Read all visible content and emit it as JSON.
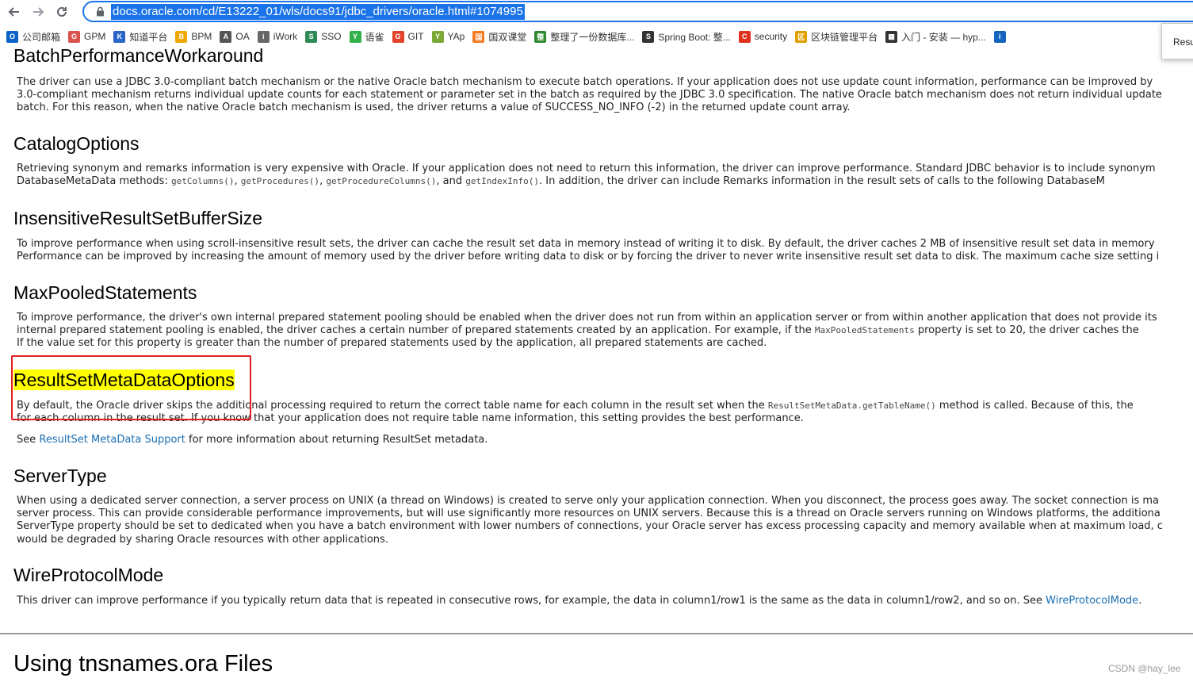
{
  "browser": {
    "url": "docs.oracle.com/cd/E13222_01/wls/docs91/jdbc_drivers/oracle.html#1074995",
    "popup_text": "Resu"
  },
  "bookmarks": [
    {
      "label": "公司邮箱",
      "icon": "mail-icon",
      "color": "#0a64c8",
      "glyph": "O"
    },
    {
      "label": "GPM",
      "icon": "gpm-icon",
      "color": "#d9534f",
      "glyph": "G"
    },
    {
      "label": "知道平台",
      "icon": "knowledge-icon",
      "color": "#2a66c9",
      "glyph": "K"
    },
    {
      "label": "BPM",
      "icon": "bpm-icon",
      "color": "#f0a800",
      "glyph": "B"
    },
    {
      "label": "OA",
      "icon": "oa-icon",
      "color": "#555555",
      "glyph": "A"
    },
    {
      "label": "iWork",
      "icon": "iwork-icon",
      "color": "#666666",
      "glyph": "i"
    },
    {
      "label": "SSO",
      "icon": "sso-icon",
      "color": "#2e8b57",
      "glyph": "S"
    },
    {
      "label": "语雀",
      "icon": "yuque-icon",
      "color": "#32b24a",
      "glyph": "Y"
    },
    {
      "label": "GIT",
      "icon": "gitlab-icon",
      "color": "#e24329",
      "glyph": "G"
    },
    {
      "label": "YAp",
      "icon": "yapi-icon",
      "color": "#7aa936",
      "glyph": "Y"
    },
    {
      "label": "国双课堂",
      "icon": "classroom-icon",
      "color": "#f47920",
      "glyph": "国"
    },
    {
      "label": "整理了一份数据库...",
      "icon": "database-icon",
      "color": "#2f8a2f",
      "glyph": "整"
    },
    {
      "label": "Spring Boot: 整...",
      "icon": "spring-icon",
      "color": "#333333",
      "glyph": "S"
    },
    {
      "label": "security",
      "icon": "csdn-icon",
      "color": "#e0311f",
      "glyph": "C"
    },
    {
      "label": "区块链管理平台",
      "icon": "blockchain-icon",
      "color": "#e0a000",
      "glyph": "区"
    },
    {
      "label": "入门 - 安装 — hyp...",
      "icon": "doc-icon",
      "color": "#333333",
      "glyph": "▦"
    },
    {
      "label": "",
      "icon": "info-icon",
      "color": "#1565c0",
      "glyph": "i"
    }
  ],
  "sections": {
    "batch": {
      "title": "BatchPerformanceWorkaround",
      "line1": "The driver can use a JDBC 3.0-compliant batch mechanism or the native Oracle batch mechanism to execute batch operations. If your application does not use update count information, performance can be improved by",
      "line2": "3.0-compliant mechanism returns individual update counts for each statement or parameter set in the batch as required by the JDBC 3.0 specification. The native Oracle batch mechanism does not return individual update",
      "line3": "batch. For this reason, when the native Oracle batch mechanism is used, the driver returns a value of SUCCESS_NO_INFO (-2) in the returned update count array."
    },
    "catalog": {
      "title": "CatalogOptions",
      "line1": "Retrieving synonym and remarks information is very expensive with Oracle. If your application does not need to return this information, the driver can improve performance. Standard JDBC behavior is to include synonym",
      "line2_a": "DatabaseMetaData methods: ",
      "code1": "getColumns()",
      "sep1": ", ",
      "code2": "getProcedures()",
      "sep2": ", ",
      "code3": "getProcedureColumns()",
      "sep3": ", and ",
      "code4": "getIndexInfo()",
      "line2_b": ". In addition, the driver can include Remarks information in the result sets of calls to the following DatabaseM"
    },
    "insensitive": {
      "title": "InsensitiveResultSetBufferSize",
      "line1": "To improve performance when using scroll-insensitive result sets, the driver can cache the result set data in memory instead of writing it to disk. By default, the driver caches 2 MB of insensitive result set data in memory",
      "line2": "Performance can be improved by increasing the amount of memory used by the driver before writing data to disk or by forcing the driver to never write insensitive result set data to disk. The maximum cache size setting i"
    },
    "maxpooled": {
      "title": "MaxPooledStatements",
      "line1": "To improve performance, the driver's own internal prepared statement pooling should be enabled when the driver does not run from within an application server or from within another application that does not provide its",
      "line2_a": "internal prepared statement pooling is enabled, the driver caches a certain number of prepared statements created by an application. For example, if the ",
      "code1": "MaxPooledStatements",
      "line2_b": " property is set to 20, the driver caches the",
      "line3": "If the value set for this property is greater than the number of prepared statements used by the application, all prepared statements are cached."
    },
    "rsmeta": {
      "title": "ResultSetMetaDataOptions",
      "line1_a": "By default, the Oracle driver skips the additional processing required to return the correct table name for each column in the result set when the ",
      "code1": "ResultSetMetaData.getTableName()",
      "line1_b": " method is called. Because of this, the",
      "line2": "for each column in the result set. If you know that your application does not require table name information, this setting provides the best performance.",
      "see_a": "See ",
      "see_link": "ResultSet MetaData Support",
      "see_b": " for more information about returning ResultSet metadata."
    },
    "servertype": {
      "title": "ServerType",
      "line1": "When using a dedicated server connection, a server process on UNIX (a thread on Windows) is created to serve only your application connection. When you disconnect, the process goes away. The socket connection is ma",
      "line2": "server process. This can provide considerable performance improvements, but will use significantly more resources on UNIX servers. Because this is a thread on Oracle servers running on Windows platforms, the additiona",
      "line3": "ServerType property should be set to dedicated when you have a batch environment with lower numbers of connections, your Oracle server has excess processing capacity and memory available when at maximum load, c",
      "line4": "would be degraded by sharing Oracle resources with other applications."
    },
    "wire": {
      "title": "WireProtocolMode",
      "line1_a": "This driver can improve performance if you typically return data that is repeated in consecutive rows, for example, the data in column1/row1 is the same as the data in column1/row2, and so on. See ",
      "link": "WireProtocolMode",
      "line1_b": "."
    }
  },
  "next_heading": "Using tnsnames.ora Files",
  "watermark": "CSDN @hay_lee"
}
